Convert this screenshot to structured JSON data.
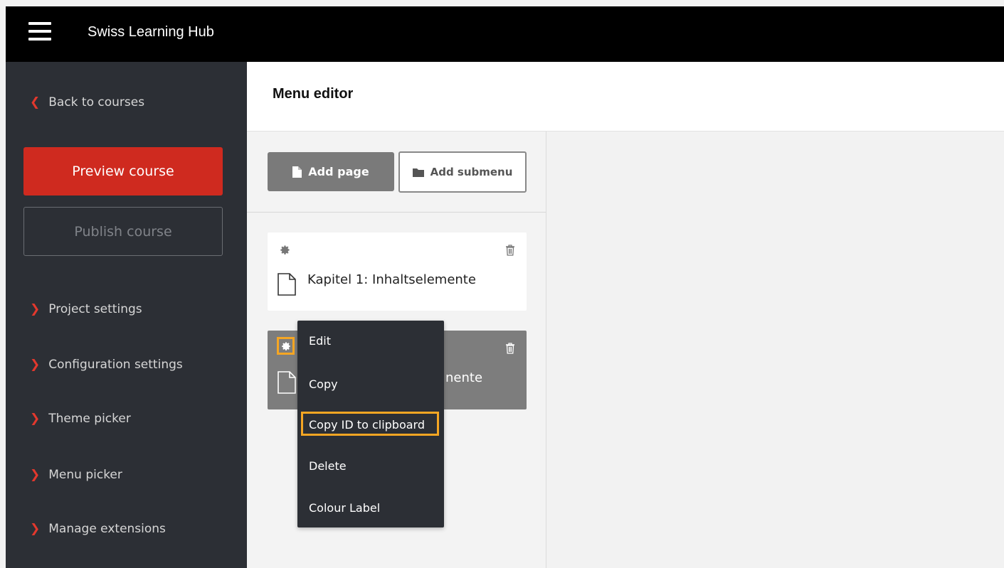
{
  "app": {
    "title": "Swiss Learning Hub"
  },
  "sidebar": {
    "back_label": "Back to courses",
    "preview_label": "Preview course",
    "publish_label": "Publish course",
    "items": [
      {
        "label": "Project settings"
      },
      {
        "label": "Configuration settings"
      },
      {
        "label": "Theme picker"
      },
      {
        "label": "Menu picker"
      },
      {
        "label": "Manage extensions"
      }
    ]
  },
  "editor": {
    "title": "Menu editor",
    "add_page_label": "Add page",
    "add_submenu_label": "Add submenu",
    "pages": [
      {
        "label": "Kapitel 1: Inhaltselemente"
      },
      {
        "label": "nente"
      }
    ]
  },
  "context_menu": {
    "items": [
      {
        "label": "Edit"
      },
      {
        "label": "Copy"
      },
      {
        "label": "Copy ID to clipboard"
      },
      {
        "label": "Delete"
      },
      {
        "label": "Colour Label"
      }
    ],
    "highlighted": "Copy ID to clipboard"
  },
  "colors": {
    "topbar": "#000000",
    "sidebar": "#2c2f35",
    "accent_red": "#cf2a1f",
    "highlight": "#f5a623"
  },
  "icons": [
    "hamburger-icon",
    "chevron-left-icon",
    "chevron-right-icon",
    "file-icon",
    "folder-icon",
    "gear-icon",
    "trash-icon",
    "page-icon"
  ]
}
